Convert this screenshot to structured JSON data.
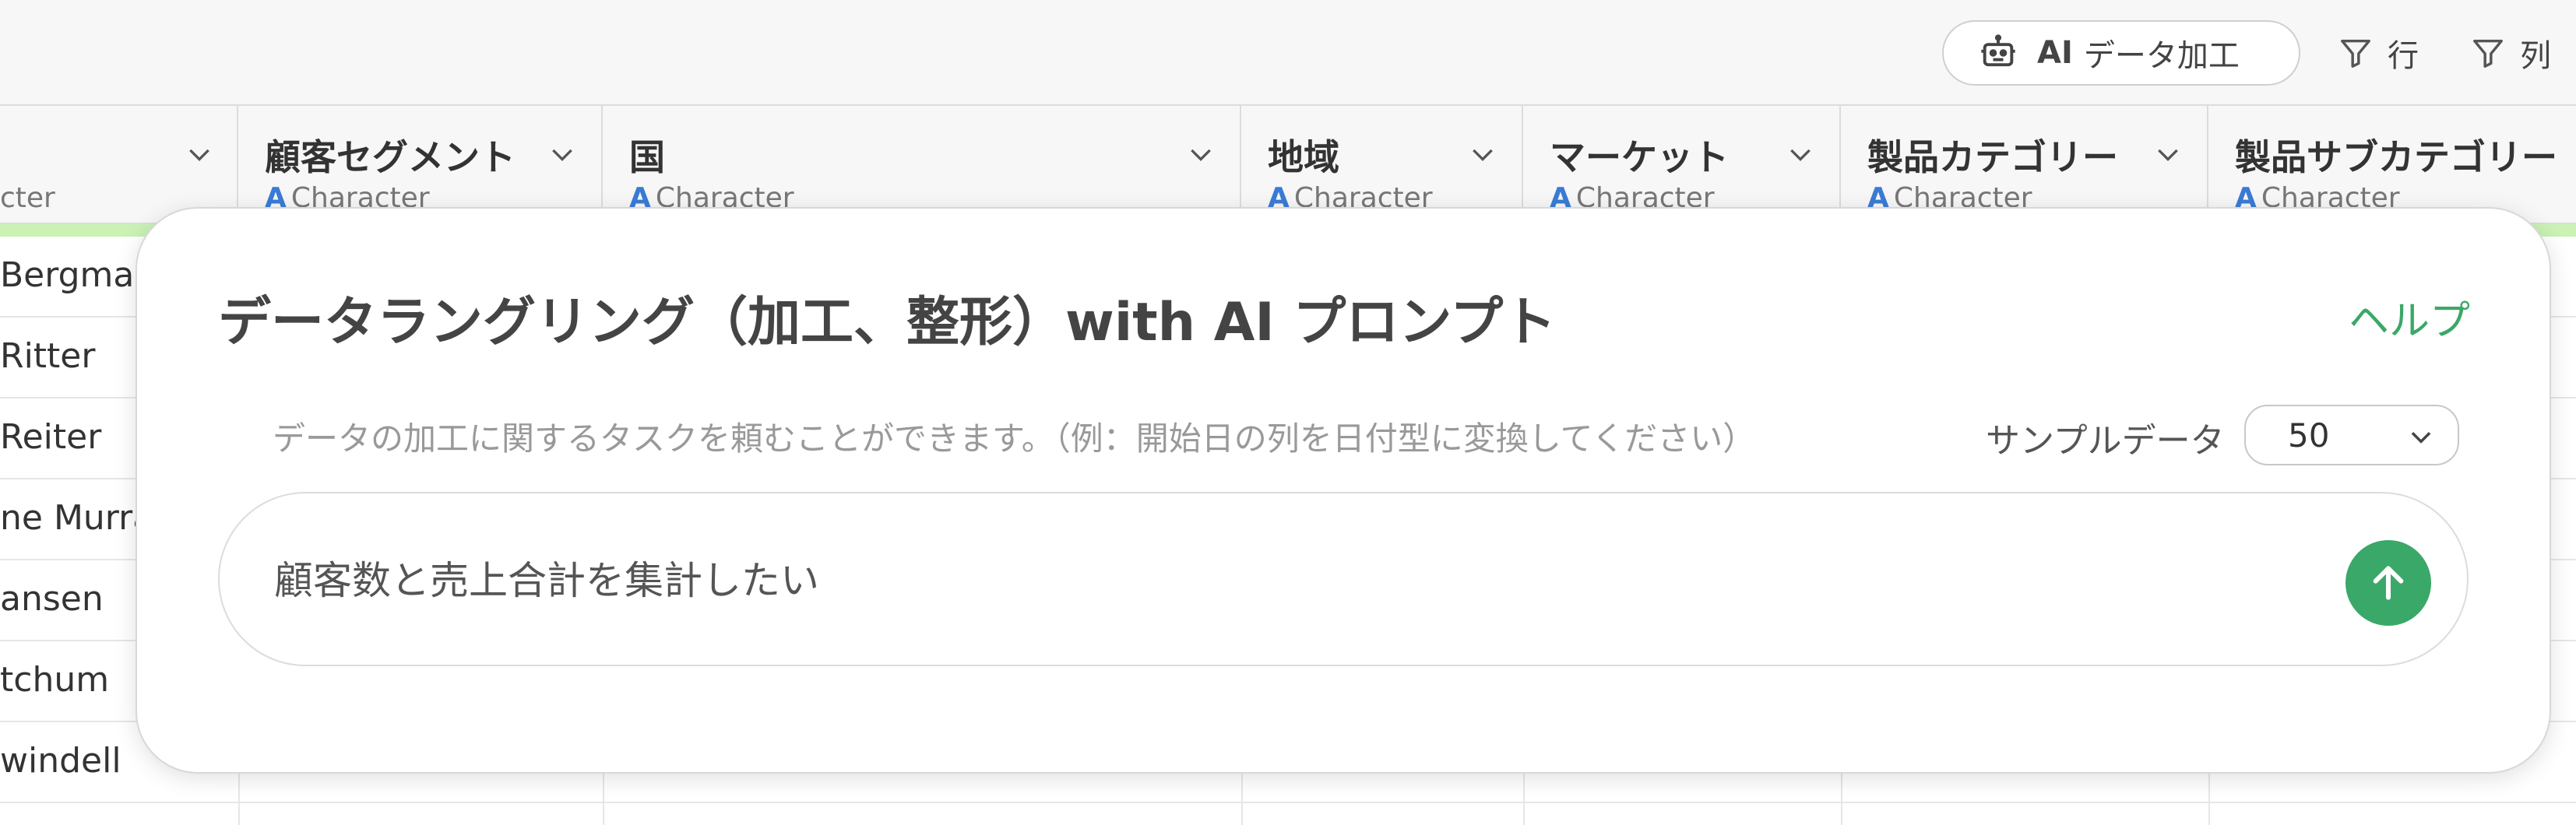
{
  "toolbar": {
    "ai_button": {
      "label_ai": "AI",
      "label_rest": "データ加工",
      "icon": "robot-icon"
    },
    "row_filter": {
      "label": "行",
      "icon": "filter-icon"
    },
    "col_filter": {
      "label": "列",
      "icon": "filter-icon"
    }
  },
  "grid": {
    "columns": [
      {
        "title": "",
        "type": "cter"
      },
      {
        "title": "顧客セグメント",
        "type": "Character"
      },
      {
        "title": "国",
        "type": "Character"
      },
      {
        "title": "地域",
        "type": "Character"
      },
      {
        "title": "マーケット",
        "type": "Character"
      },
      {
        "title": "製品カテゴリー",
        "type": "Character"
      },
      {
        "title": "製品サブカテゴリー",
        "type": "Character"
      }
    ],
    "type_icon": "A",
    "rows": [
      "Bergman",
      "Ritter",
      "Reiter",
      "ne Murra",
      "ansen",
      "tchum",
      "windell"
    ]
  },
  "modal": {
    "title": "データラングリング（加工、整形）with AI プロンプト",
    "help": "ヘルプ",
    "description": "データの加工に関するタスクを頼むことができます。（例：開始日の列を日付型に変換してください）",
    "sample_label": "サンプルデータ",
    "sample_value": "50",
    "prompt_value": "顧客数と売上合計を集計したい",
    "send_icon": "arrow-up-icon"
  },
  "colors": {
    "accent_green": "#3aa868",
    "type_blue": "#3a7bd5",
    "highlight_strip": "#c9f2b4"
  }
}
